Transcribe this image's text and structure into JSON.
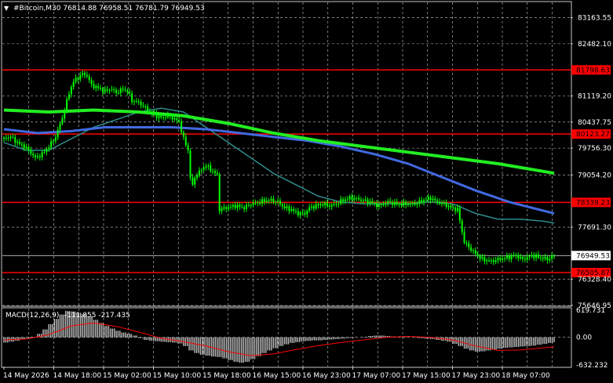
{
  "header": {
    "arrow": "▼",
    "text": "#Bitcoin,M30  76814.88 76958.51 76781.79 76949.53"
  },
  "colors": {
    "background": "#000000",
    "grid": "#c8c8c8",
    "candles": "#00ff00",
    "ma_fast": "#2e8b8b",
    "ma_mid": "#4169e1",
    "ma_slow": "#22ee22",
    "hline": "#ff0000",
    "macd_hist": "#c0c0c0",
    "macd_signal": "#ff0000"
  },
  "chart_data": [
    {
      "type": "candlestick",
      "symbol": "#Bitcoin",
      "timeframe": "M30",
      "ohlc_last": {
        "open": 76814.88,
        "high": 76958.51,
        "low": 76781.79,
        "close": 76949.53
      },
      "y_axis": {
        "ylim": [
          75646.95,
          83563.55
        ],
        "ticks": [
          "83163.55",
          "82482.10",
          "81119.20",
          "80437.75",
          "79756.30",
          "79054.20",
          "77691.30",
          "76328.40",
          "75646.95"
        ]
      },
      "x_axis": {
        "ticks": [
          "14 May 2026",
          "14 May 18:00",
          "15 May 02:00",
          "15 May 10:00",
          "15 May 18:00",
          "16 May 15:00",
          "16 May 23:00",
          "17 May 07:00",
          "17 May 15:00",
          "17 May 23:00",
          "18 May 07:00"
        ]
      },
      "horizontal_lines": [
        {
          "value": 81798.63,
          "label": "81798.63"
        },
        {
          "value": 80123.27,
          "label": "80123.27"
        },
        {
          "value": 78339.23,
          "label": "78339.23"
        },
        {
          "value": 76505.87,
          "label": "76505.87"
        }
      ],
      "current_price": {
        "value": 76949.53,
        "label": "76949.53"
      },
      "close_path": [
        [
          0,
          80000
        ],
        [
          6,
          80050
        ],
        [
          12,
          79900
        ],
        [
          18,
          79800
        ],
        [
          22,
          79700
        ],
        [
          28,
          79500
        ],
        [
          34,
          79600
        ],
        [
          40,
          79800
        ],
        [
          46,
          80050
        ],
        [
          52,
          80550
        ],
        [
          58,
          81200
        ],
        [
          62,
          81500
        ],
        [
          66,
          81600
        ],
        [
          70,
          81700
        ],
        [
          74,
          81650
        ],
        [
          78,
          81400
        ],
        [
          82,
          81350
        ],
        [
          86,
          81300
        ],
        [
          90,
          81250
        ],
        [
          96,
          81300
        ],
        [
          100,
          81200
        ],
        [
          106,
          81300
        ],
        [
          110,
          81250
        ],
        [
          114,
          81000
        ],
        [
          120,
          80950
        ],
        [
          126,
          80800
        ],
        [
          130,
          80700
        ],
        [
          136,
          80600
        ],
        [
          140,
          80550
        ],
        [
          146,
          80600
        ],
        [
          150,
          80550
        ],
        [
          156,
          80450
        ],
        [
          160,
          80000
        ],
        [
          164,
          79700
        ],
        [
          167,
          78650
        ],
        [
          170,
          79000
        ],
        [
          176,
          79200
        ],
        [
          180,
          79300
        ],
        [
          184,
          79200
        ],
        [
          188,
          79100
        ],
        [
          190,
          79050
        ],
        [
          192,
          78150
        ],
        [
          198,
          78200
        ],
        [
          206,
          78250
        ],
        [
          214,
          78200
        ],
        [
          220,
          78300
        ],
        [
          228,
          78350
        ],
        [
          236,
          78400
        ],
        [
          244,
          78350
        ],
        [
          250,
          78200
        ],
        [
          256,
          78150
        ],
        [
          262,
          78050
        ],
        [
          268,
          78050
        ],
        [
          272,
          78200
        ],
        [
          278,
          78250
        ],
        [
          284,
          78300
        ],
        [
          290,
          78250
        ],
        [
          296,
          78300
        ],
        [
          302,
          78400
        ],
        [
          308,
          78450
        ],
        [
          312,
          78450
        ],
        [
          318,
          78400
        ],
        [
          326,
          78350
        ],
        [
          334,
          78250
        ],
        [
          342,
          78350
        ],
        [
          350,
          78300
        ],
        [
          358,
          78300
        ],
        [
          366,
          78300
        ],
        [
          374,
          78400
        ],
        [
          380,
          78450
        ],
        [
          386,
          78350
        ],
        [
          392,
          78300
        ],
        [
          398,
          78200
        ],
        [
          404,
          78150
        ],
        [
          410,
          77300
        ],
        [
          418,
          77050
        ],
        [
          426,
          76850
        ],
        [
          434,
          76800
        ],
        [
          440,
          76850
        ],
        [
          448,
          76900
        ],
        [
          456,
          76950
        ],
        [
          462,
          76850
        ],
        [
          470,
          76950
        ],
        [
          478,
          76900
        ],
        [
          484,
          76850
        ],
        [
          490,
          76949.53
        ]
      ],
      "ma_fast": [
        [
          0,
          79900
        ],
        [
          20,
          79700
        ],
        [
          40,
          79700
        ],
        [
          60,
          80000
        ],
        [
          80,
          80300
        ],
        [
          100,
          80500
        ],
        [
          120,
          80700
        ],
        [
          140,
          80800
        ],
        [
          160,
          80700
        ],
        [
          180,
          80300
        ],
        [
          200,
          79900
        ],
        [
          220,
          79500
        ],
        [
          240,
          79100
        ],
        [
          260,
          78800
        ],
        [
          280,
          78500
        ],
        [
          300,
          78350
        ],
        [
          320,
          78300
        ],
        [
          340,
          78300
        ],
        [
          360,
          78300
        ],
        [
          380,
          78350
        ],
        [
          400,
          78300
        ],
        [
          420,
          78050
        ],
        [
          440,
          77900
        ],
        [
          460,
          77900
        ],
        [
          480,
          77850
        ],
        [
          490,
          77800
        ]
      ],
      "ma_mid": [
        [
          0,
          80250
        ],
        [
          30,
          80150
        ],
        [
          60,
          80200
        ],
        [
          90,
          80300
        ],
        [
          120,
          80300
        ],
        [
          150,
          80300
        ],
        [
          180,
          80250
        ],
        [
          210,
          80150
        ],
        [
          240,
          80050
        ],
        [
          270,
          79950
        ],
        [
          300,
          79800
        ],
        [
          330,
          79600
        ],
        [
          360,
          79350
        ],
        [
          390,
          79000
        ],
        [
          420,
          78650
        ],
        [
          450,
          78350
        ],
        [
          490,
          78050
        ]
      ],
      "ma_slow": [
        [
          0,
          80750
        ],
        [
          40,
          80700
        ],
        [
          80,
          80750
        ],
        [
          120,
          80700
        ],
        [
          160,
          80600
        ],
        [
          200,
          80400
        ],
        [
          240,
          80150
        ],
        [
          280,
          79950
        ],
        [
          320,
          79800
        ],
        [
          360,
          79650
        ],
        [
          400,
          79500
        ],
        [
          440,
          79350
        ],
        [
          490,
          79100
        ]
      ]
    },
    {
      "type": "bar",
      "title": "MACD(12,26,9)",
      "values_label": "-111.855 -217.435",
      "y_axis": {
        "ylim": [
          -632.232,
          619.731
        ],
        "ticks": [
          "619.731",
          "0.00",
          "-632.232"
        ]
      },
      "histogram": [
        [
          0,
          -120
        ],
        [
          5,
          -100
        ],
        [
          10,
          -80
        ],
        [
          15,
          -50
        ],
        [
          20,
          -20
        ],
        [
          25,
          10
        ],
        [
          30,
          80
        ],
        [
          35,
          180
        ],
        [
          40,
          300
        ],
        [
          45,
          420
        ],
        [
          50,
          520
        ],
        [
          55,
          600
        ],
        [
          60,
          590
        ],
        [
          65,
          560
        ],
        [
          70,
          530
        ],
        [
          75,
          480
        ],
        [
          80,
          400
        ],
        [
          85,
          330
        ],
        [
          90,
          260
        ],
        [
          95,
          200
        ],
        [
          100,
          150
        ],
        [
          105,
          110
        ],
        [
          110,
          80
        ],
        [
          115,
          40
        ],
        [
          120,
          -20
        ],
        [
          125,
          -60
        ],
        [
          130,
          -80
        ],
        [
          135,
          -90
        ],
        [
          140,
          -100
        ],
        [
          145,
          -110
        ],
        [
          150,
          -120
        ],
        [
          155,
          -140
        ],
        [
          160,
          -200
        ],
        [
          165,
          -300
        ],
        [
          170,
          -360
        ],
        [
          175,
          -400
        ],
        [
          180,
          -420
        ],
        [
          185,
          -440
        ],
        [
          190,
          -450
        ],
        [
          195,
          -480
        ],
        [
          200,
          -520
        ],
        [
          205,
          -560
        ],
        [
          210,
          -580
        ],
        [
          215,
          -560
        ],
        [
          220,
          -500
        ],
        [
          225,
          -430
        ],
        [
          230,
          -360
        ],
        [
          235,
          -300
        ],
        [
          240,
          -250
        ],
        [
          245,
          -200
        ],
        [
          250,
          -160
        ],
        [
          255,
          -130
        ],
        [
          260,
          -110
        ],
        [
          265,
          -90
        ],
        [
          270,
          -80
        ],
        [
          275,
          -70
        ],
        [
          280,
          -70
        ],
        [
          285,
          -60
        ],
        [
          290,
          -50
        ],
        [
          295,
          -40
        ],
        [
          300,
          -30
        ],
        [
          305,
          -20
        ],
        [
          310,
          -10
        ],
        [
          315,
          0
        ],
        [
          320,
          10
        ],
        [
          325,
          30
        ],
        [
          330,
          40
        ],
        [
          335,
          40
        ],
        [
          340,
          30
        ],
        [
          345,
          20
        ],
        [
          350,
          20
        ],
        [
          355,
          10
        ],
        [
          360,
          0
        ],
        [
          365,
          -10
        ],
        [
          370,
          -20
        ],
        [
          375,
          -30
        ],
        [
          380,
          -40
        ],
        [
          385,
          -60
        ],
        [
          390,
          -80
        ],
        [
          395,
          -100
        ],
        [
          400,
          -150
        ],
        [
          405,
          -200
        ],
        [
          410,
          -260
        ],
        [
          415,
          -300
        ],
        [
          420,
          -330
        ],
        [
          425,
          -320
        ],
        [
          430,
          -300
        ],
        [
          435,
          -280
        ],
        [
          440,
          -260
        ],
        [
          445,
          -240
        ],
        [
          450,
          -230
        ],
        [
          455,
          -220
        ],
        [
          460,
          -210
        ],
        [
          465,
          -200
        ],
        [
          470,
          -190
        ],
        [
          475,
          -170
        ],
        [
          480,
          -150
        ],
        [
          485,
          -130
        ],
        [
          490,
          -112
        ]
      ],
      "signal": [
        [
          0,
          -60
        ],
        [
          20,
          -40
        ],
        [
          40,
          60
        ],
        [
          60,
          260
        ],
        [
          80,
          330
        ],
        [
          100,
          250
        ],
        [
          120,
          120
        ],
        [
          140,
          -20
        ],
        [
          160,
          -100
        ],
        [
          180,
          -200
        ],
        [
          200,
          -330
        ],
        [
          220,
          -420
        ],
        [
          240,
          -380
        ],
        [
          260,
          -280
        ],
        [
          280,
          -190
        ],
        [
          300,
          -120
        ],
        [
          320,
          -60
        ],
        [
          340,
          0
        ],
        [
          360,
          20
        ],
        [
          380,
          0
        ],
        [
          400,
          -60
        ],
        [
          420,
          -200
        ],
        [
          440,
          -300
        ],
        [
          460,
          -290
        ],
        [
          480,
          -240
        ],
        [
          490,
          -217
        ]
      ]
    }
  ]
}
